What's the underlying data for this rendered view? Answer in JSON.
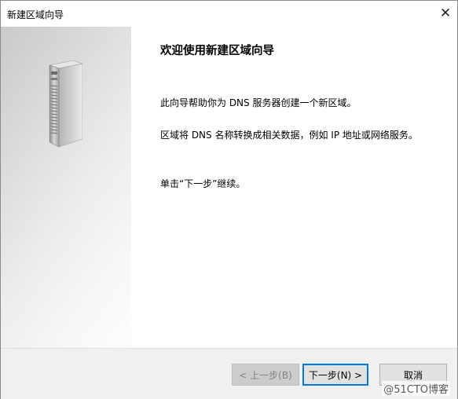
{
  "window": {
    "title": "新建区域向导",
    "close_glyph": "✕"
  },
  "sidebar": {
    "icon": "server-icon"
  },
  "content": {
    "heading": "欢迎使用新建区域向导",
    "paragraph1": "此向导帮助你为 DNS 服务器创建一个新区域。",
    "paragraph2": "区域将 DNS 名称转换成相关数据，例如 IP 地址或网络服务。",
    "paragraph3": "单击“下一步”继续。"
  },
  "buttons": {
    "back": "< 上一步(B)",
    "next": "下一步(N) >",
    "cancel": "取消"
  },
  "watermark": "@51CTO博客",
  "colors": {
    "accent": "#0078d7",
    "disabled_text": "#838383",
    "footer_bg": "#f0f0f0"
  }
}
